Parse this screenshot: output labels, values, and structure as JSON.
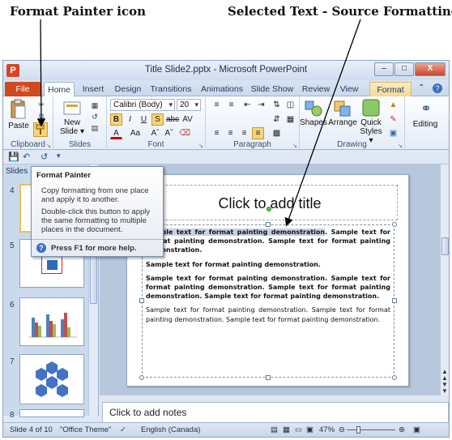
{
  "annotations": {
    "format_painter": "Format Painter icon",
    "selected_text": "Selected Text - Source Formatting"
  },
  "window": {
    "title": "Title Slide2.pptx - Microsoft PowerPoint",
    "app_icon": "P",
    "minimize": "–",
    "restore": "□",
    "close": "X"
  },
  "tabs": [
    {
      "label": "File"
    },
    {
      "label": "Home"
    },
    {
      "label": "Insert"
    },
    {
      "label": "Design"
    },
    {
      "label": "Transitions"
    },
    {
      "label": "Animations"
    },
    {
      "label": "Slide Show"
    },
    {
      "label": "Review"
    },
    {
      "label": "View"
    },
    {
      "label": "Format"
    }
  ],
  "ribbon": {
    "clipboard": {
      "label": "Clipboard",
      "paste": "Paste"
    },
    "slides": {
      "label": "Slides",
      "new_slide_1": "New",
      "new_slide_2": "Slide ▾"
    },
    "font": {
      "label": "Font",
      "font_name": "Calibri (Body)",
      "font_size": "20"
    },
    "paragraph": {
      "label": "Paragraph"
    },
    "drawing": {
      "label": "Drawing",
      "shapes": "Shapes",
      "arrange": "Arrange",
      "quick_1": "Quick",
      "quick_2": "Styles ▾"
    },
    "editing": {
      "label": "Editing"
    }
  },
  "slides_pane": {
    "tab": "Slides",
    "numbers": [
      "4",
      "5",
      "6",
      "7",
      "8"
    ]
  },
  "tooltip": {
    "title": "Format Painter",
    "para1": "Copy formatting from one place and apply it to another.",
    "para2": "Double-click this button to apply the same formatting to multiple places in the document.",
    "help": "Press F1 for more help."
  },
  "slide": {
    "title_placeholder": "Click to add title",
    "p1_selected": "Sample text for format painting demonstration",
    "p1_rest": ". Sample text for format painting demonstration. Sample text for format painting demonstration.",
    "p2": "Sample text for format painting demonstration.",
    "p3": "Sample text for format painting demonstration. Sample text for format painting demonstration. Sample text for format painting demonstration. Sample text for format painting demonstration.",
    "p4": "Sample text for format painting demonstration. Sample text for format painting demonstration. Sample text for format painting demonstration."
  },
  "notes": {
    "placeholder": "Click to add notes"
  },
  "status": {
    "slide": "Slide 4 of 10",
    "theme": "\"Office Theme\"",
    "language": "English (Canada)",
    "zoom": "47%",
    "zoom_level": 0.47
  },
  "colors": {
    "file_tab": "#d04a1f",
    "accent": "#2b579a",
    "highlight": "#f6d478"
  }
}
